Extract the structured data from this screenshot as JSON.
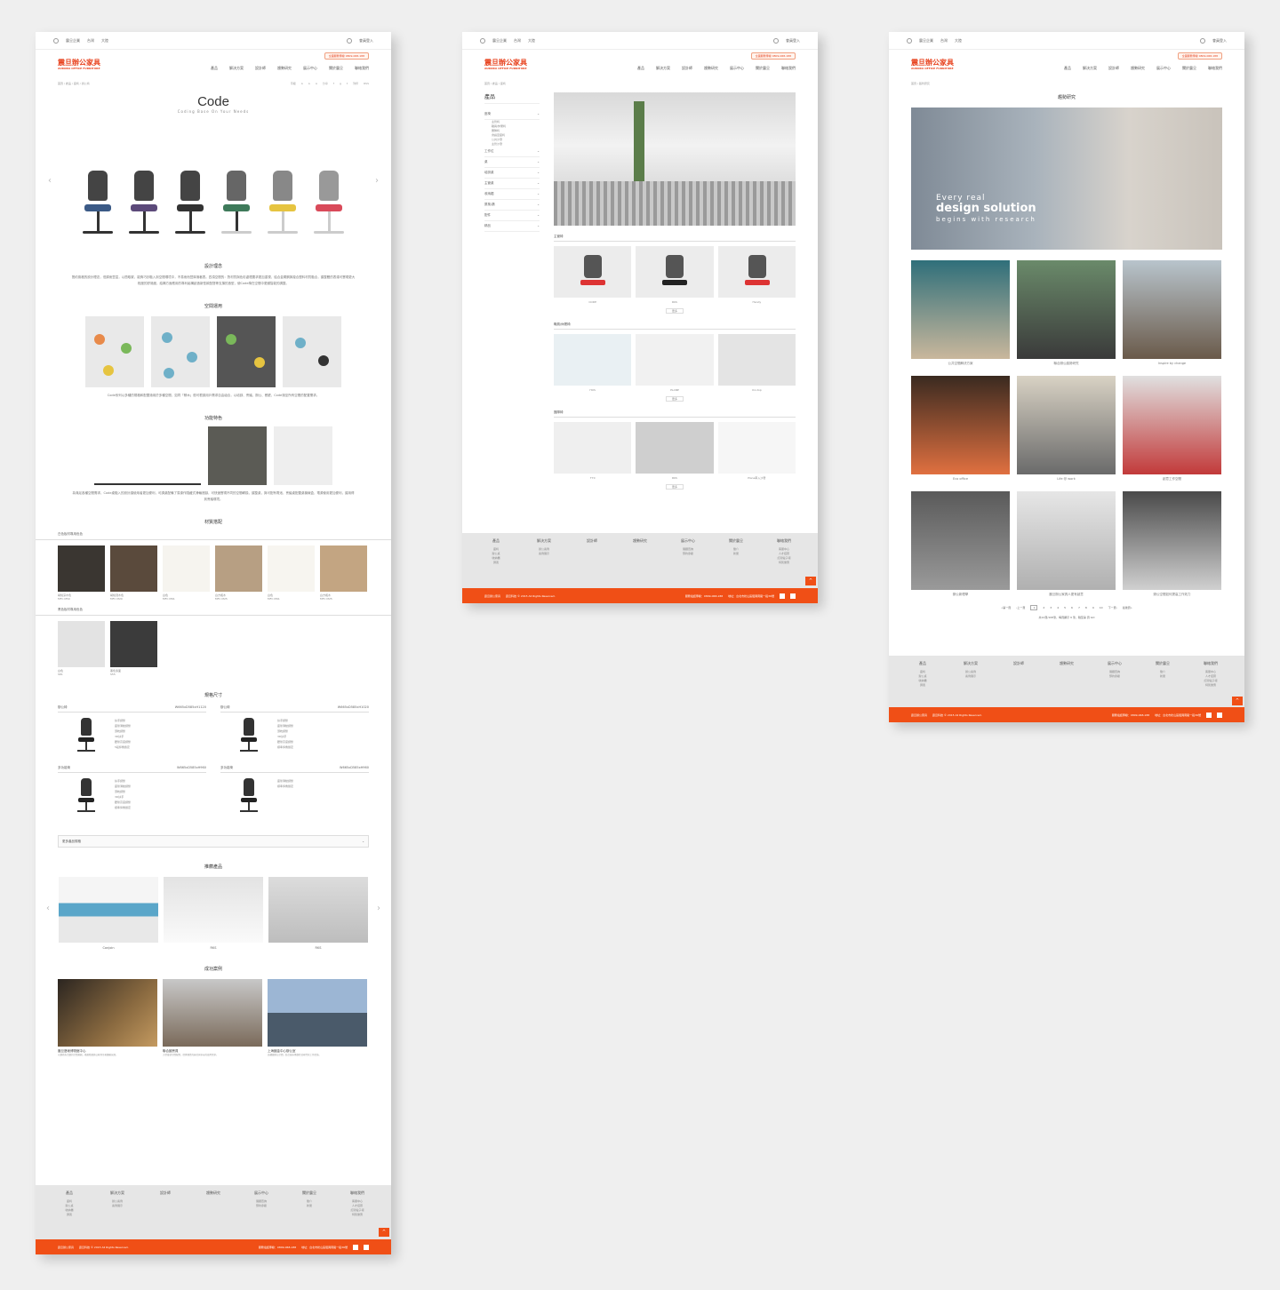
{
  "topbar": {
    "brand": "震旦企業",
    "region": "台灣",
    "lang": "大陸",
    "login": "會員登入"
  },
  "brand": {
    "name": "震旦辦公家具",
    "sub": "AURORA OFFICE FURNITURE",
    "phone": "全國服務專線 0809-068-188"
  },
  "nav": [
    "產品",
    "解決方案",
    "設計師",
    "趨勢研究",
    "展示中心",
    "關於震旦",
    "聯絡我們"
  ],
  "page1": {
    "breadcrumb": "首頁 / 產品 / 座椅 / 辦公椅",
    "share": [
      "字級",
      "A",
      "A",
      "A",
      "分享",
      "f",
      "g",
      "t",
      "列印",
      "RSS"
    ],
    "title": "Code",
    "subtitle": "Coding Base On Your Needs",
    "concept_title": "設計理念",
    "concept_text": "簡約風格的設計理念，低調而豐富，以簡取繁，能夠巧妙融入到空間環境中，不易而而豐厚適著表。四項空間的：對材質與色彩處理要求更加重視，結合金屬鋼與複合塑料材質融合，讓整體的表達可實現更大程度的舒適度，結構方面應用的專利組構創造新型款配搭等支撐的造型，使Code椅在空間中更顯智能的調整。",
    "space_title": "空間運用",
    "space_text": "Code系列以多種的規格和配置適用於多種空間，如同「積木」般可根據用戶需求自由組合，以培訓、會議、辦公、餐廳，Code適至所有空間的配置需求。",
    "feature_title": "功能特色",
    "feature_text": "為滿足各種空間需求，Code桌融入的設計讓使用者更加便利，可調桌配備了易操作隱藏式滑輪底腳，可快速實現不同的空間轉換，讓整桌，與可配有電池、會議桌配置桌機線盒，電源使用更加便利，讓用得到會議環境。",
    "material_title": "材質搭配",
    "material_group1": "白色板材專用色色",
    "swatches1": [
      {
        "name": "胡桃深木色",
        "code": "MFC M50",
        "color": "#3a3631"
      },
      {
        "name": "胡桃淺木色",
        "code": "MFC M20",
        "color": "#5a4a3c"
      },
      {
        "name": "白色",
        "code": "MFC M91",
        "color": "#f6f4ef"
      },
      {
        "name": "白方楓木",
        "code": "MFC M25",
        "color": "#b79f83"
      },
      {
        "name": "白色",
        "code": "MFC M91",
        "color": "#f7f5f0"
      },
      {
        "name": "白方楓木",
        "code": "MFC M25",
        "color": "#c3a582"
      }
    ],
    "material_group2": "黑色板材專用色色",
    "swatches2": [
      {
        "name": "白色",
        "code": "S81",
        "color": "#e3e3e3"
      },
      {
        "name": "黑色漆面",
        "code": "S55",
        "color": "#3b3b3b"
      }
    ],
    "spec_title": "規格尺寸",
    "specs": [
      {
        "name": "辦公椅",
        "dims": "W665xD585xH1120",
        "features": [
          "扶手調整",
          "座墊滑動調整",
          "頭枕調整",
          "3D扶手",
          "腰墊高度調整",
          "5段仰角鎖定"
        ]
      },
      {
        "name": "辦公椅",
        "dims": "W665xD585xH1020",
        "features": [
          "扶手調整",
          "座墊滑動調整",
          "頭枕調整",
          "3D扶手",
          "腰墊高度調整",
          "標準仰角鎖定"
        ]
      },
      {
        "name": "多功能椅",
        "dims": "W665xD585xH960",
        "features": [
          "扶手調整",
          "座墊滑動調整",
          "頭枕調整",
          "3D扶手",
          "腰墊高度調整",
          "標準仰角鎖定"
        ]
      },
      {
        "name": "多功能椅",
        "dims": "W665xD585xH960",
        "features": [
          "座墊滑動調整",
          "標準仰角鎖定"
        ]
      }
    ],
    "collapse": "更多產品規格",
    "related_title": "推薦產品",
    "related": [
      "Conjoin",
      "RKS",
      "RKS"
    ],
    "cases_title": "成功案例",
    "cases": [
      {
        "title": "震旦藝術博物館中心",
        "desc": "以藝術為主題的空間規劃，搭配精選辦公家具呈現優雅氛圍。"
      },
      {
        "title": "聯合國會員",
        "desc": "大型會議空間配置，提供彈性的座位與多元的使用需求。"
      },
      {
        "title": "上海國金中心辦公室",
        "desc": "高樓層辦公空間，結合城市景觀打造現代化工作環境。"
      }
    ]
  },
  "page2": {
    "breadcrumb": "首頁 / 產品 / 座椅",
    "side_title": "產品",
    "side_items": [
      "座椅",
      "工作位",
      "桌",
      "培訓桌",
      "主管桌",
      "收納櫃",
      "屏風/牆",
      "配件",
      "精品"
    ],
    "side_subs": [
      "主管椅",
      "職員/休閒椅",
      "團隊椅",
      "會議室座椅",
      "公共沙發",
      "主管沙發"
    ],
    "sections": [
      {
        "title": "主管椅",
        "items": [
          "CODE",
          "RKS",
          "Handy"
        ]
      },
      {
        "title": "職員/休閒椅",
        "items": [
          "HOS",
          "PLANE",
          "Uni-top"
        ]
      },
      {
        "title": "團隊椅",
        "items": [
          "T70",
          "RKS",
          "Plane車入沙發"
        ]
      }
    ],
    "more": "更多"
  },
  "page3": {
    "breadcrumb": "首頁 / 趨勢研究",
    "title": "趨勢研究",
    "hero_a": "Every real",
    "hero_b": "design solution",
    "hero_c": "begins with research",
    "tiles": [
      "公共空間解決方案",
      "聯合辦公趨勢研究",
      "Inspire by change",
      "Eco office",
      "Life @ work",
      "創意工作空間",
      "辦公新理學",
      "震旦辦公家具人更有創意",
      "辦公空間如何提高工作效力"
    ],
    "pager": [
      "«第一頁",
      "‹上一頁",
      "1",
      "2",
      "3",
      "4",
      "5",
      "6",
      "7",
      "8",
      "9",
      "10",
      "下一頁›",
      "最後頁»"
    ],
    "pager_info": "共12頁/108筆，每頁顯示 9 筆，跳至第 頁 GO"
  },
  "footer": {
    "cols": [
      {
        "hd": "產品",
        "items": [
          "座椅",
          "辦公桌",
          "收納櫃",
          "屏風"
        ]
      },
      {
        "hd": "解決方案",
        "items": [
          "辦公案例",
          "案例展示"
        ]
      },
      {
        "hd": "設計師",
        "items": []
      },
      {
        "hd": "趨勢研究",
        "items": []
      },
      {
        "hd": "展示中心",
        "items": [
          "展廳查詢",
          "預約參觀"
        ]
      },
      {
        "hd": "關於震旦",
        "items": [
          "簡介",
          "新聞"
        ]
      },
      {
        "hd": "聯絡我們",
        "items": [
          "客服中心",
          "人才招募",
          "訂閱電子報",
          "特別優惠"
        ]
      }
    ],
    "copyright": "震旦科技 © 2015 All Rights Reserved.",
    "service": "服務電話專線：0809-068-188",
    "address": "地址：台北市松山區復興南路一段36號",
    "totop": "^"
  }
}
